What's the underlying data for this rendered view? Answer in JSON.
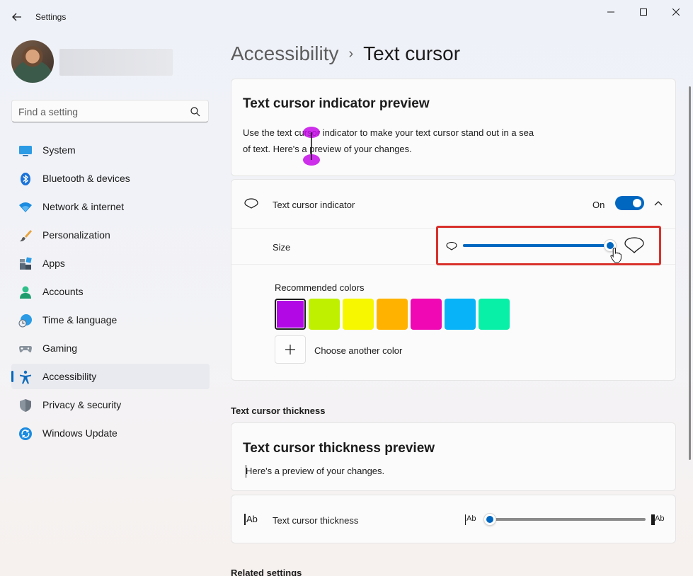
{
  "window": {
    "title": "Settings"
  },
  "search": {
    "placeholder": "Find a setting"
  },
  "sidebar": {
    "items": [
      {
        "label": "System",
        "icon": "monitor-icon"
      },
      {
        "label": "Bluetooth & devices",
        "icon": "bluetooth-icon"
      },
      {
        "label": "Network & internet",
        "icon": "wifi-icon"
      },
      {
        "label": "Personalization",
        "icon": "brush-icon"
      },
      {
        "label": "Apps",
        "icon": "apps-icon"
      },
      {
        "label": "Accounts",
        "icon": "person-icon"
      },
      {
        "label": "Time & language",
        "icon": "clock-globe-icon"
      },
      {
        "label": "Gaming",
        "icon": "gamepad-icon"
      },
      {
        "label": "Accessibility",
        "icon": "accessibility-icon",
        "active": true
      },
      {
        "label": "Privacy & security",
        "icon": "shield-icon"
      },
      {
        "label": "Windows Update",
        "icon": "update-icon"
      }
    ]
  },
  "header": {
    "parent": "Accessibility",
    "separator": "›",
    "current": "Text cursor"
  },
  "indicator_preview": {
    "title": "Text cursor indicator preview",
    "text_line1": "Use the text cursor indicator to make your text cursor stand out in a sea",
    "text_line2": "of text. Here's a preview of your changes."
  },
  "indicator": {
    "label": "Text cursor indicator",
    "state_label": "On",
    "enabled": true,
    "size_label": "Size",
    "size_value_fraction": 0.98,
    "colors_label": "Recommended colors",
    "colors": [
      "#b208e6",
      "#bff000",
      "#f7f700",
      "#ffb300",
      "#f008b4",
      "#08b4f7",
      "#08f0a8"
    ],
    "selected_color": 0,
    "choose_color_label": "Choose another color"
  },
  "thickness": {
    "section_heading": "Text cursor thickness",
    "preview_title": "Text cursor thickness preview",
    "preview_text": "Here's a preview of your changes.",
    "label": "Text cursor thickness",
    "slider_min_glyph": "Ab",
    "slider_max_glyph": "Ab",
    "value_fraction": 0.0
  },
  "related": {
    "heading": "Related settings"
  },
  "colors": {
    "accent": "#0067c0",
    "highlight": "#d9312c",
    "indicator_purple": "#c40ae8"
  }
}
